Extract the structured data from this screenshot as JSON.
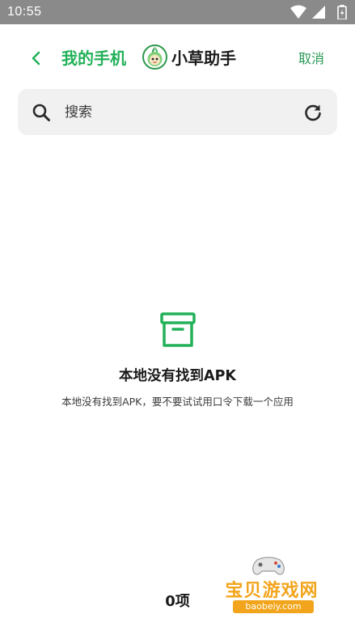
{
  "status_bar": {
    "time": "10:55",
    "icons": [
      "wifi-icon",
      "signal-icon",
      "battery-icon"
    ]
  },
  "header": {
    "back_icon": "chevron-left-icon",
    "title": "我的手机",
    "app_name": "小草助手",
    "cancel_label": "取消"
  },
  "search": {
    "placeholder": "搜索",
    "value": "",
    "search_icon": "search-icon",
    "refresh_icon": "refresh-icon"
  },
  "empty_state": {
    "icon": "archive-box-icon",
    "title": "本地没有找到APK",
    "description": "本地没有找到APK，要不要试试用口令下载一个应用"
  },
  "footer": {
    "count_label": "0项"
  },
  "watermark": {
    "text": "宝贝游戏网",
    "url": "baobeiy.com"
  },
  "colors": {
    "accent": "#22b159",
    "cancel": "#2a9a56",
    "status_bar": "#8a8a8a",
    "search_bg": "#f1f1f2",
    "watermark": "#f2a51c"
  }
}
